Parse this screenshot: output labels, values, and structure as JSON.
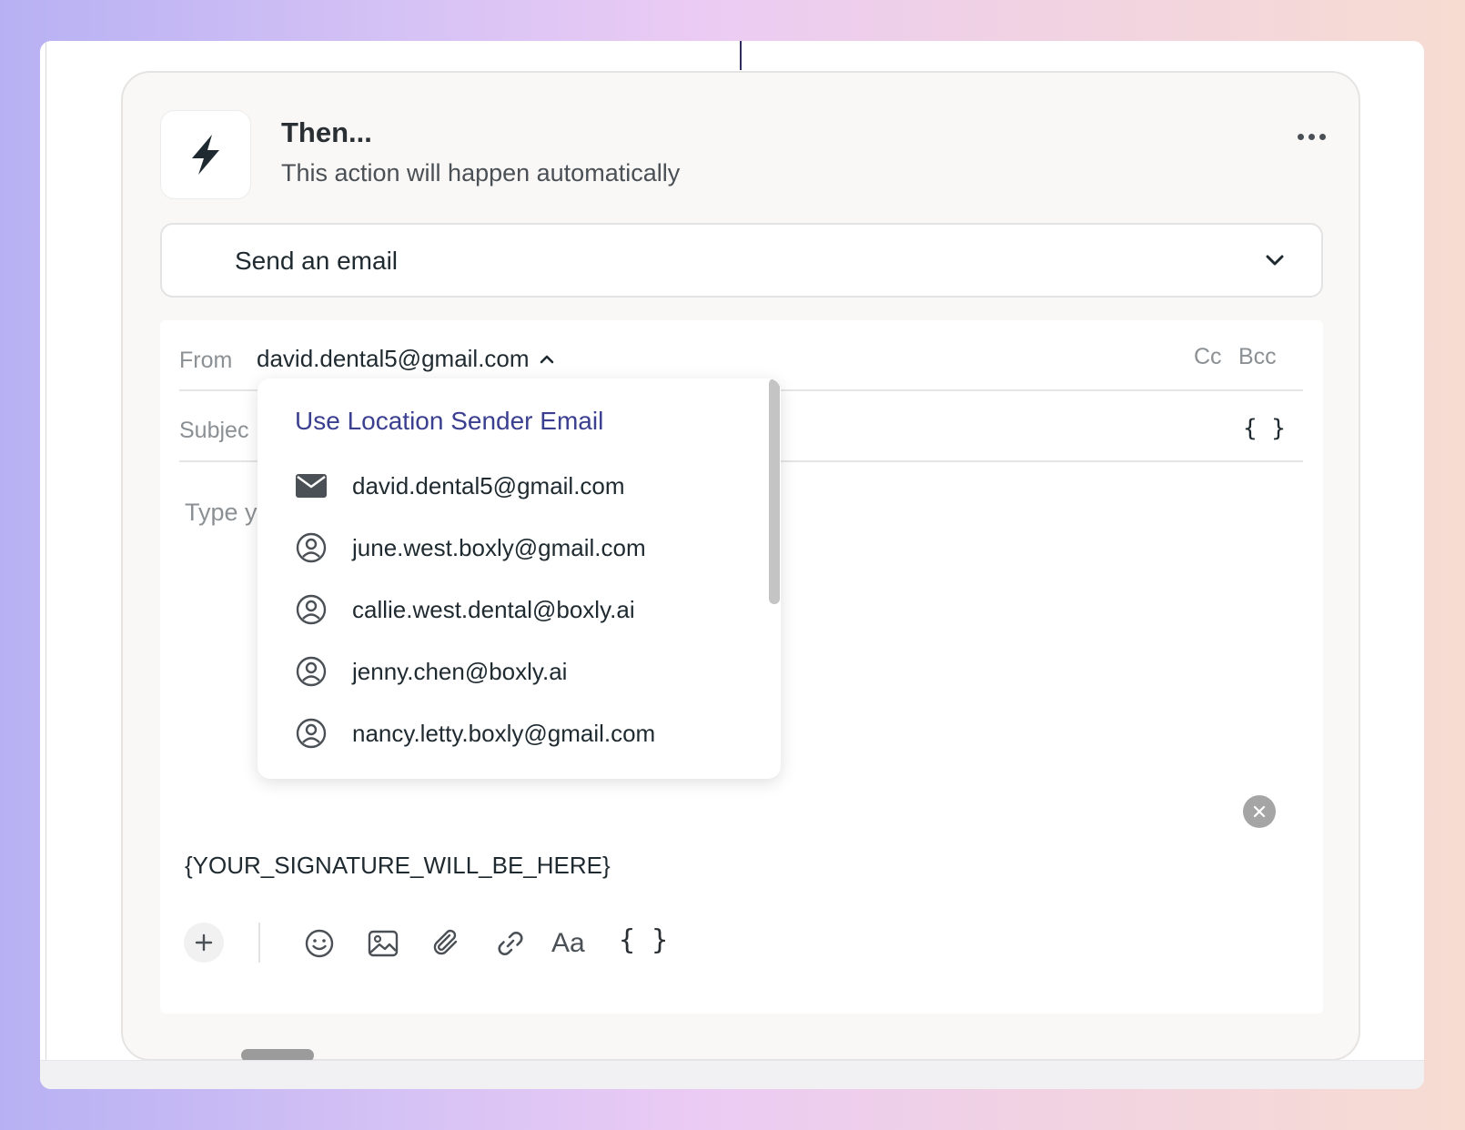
{
  "card": {
    "title": "Then...",
    "subtitle": "This action will happen automatically",
    "icon": "lightning-bolt-icon"
  },
  "action_select": {
    "value": "Send an email"
  },
  "email": {
    "from_label": "From",
    "from_value": "david.dental5@gmail.com",
    "cc_label": "Cc",
    "bcc_label": "Bcc",
    "subject_label": "Subjec",
    "body_placeholder": "Type y",
    "signature": "{YOUR_SIGNATURE_WILL_BE_HERE}",
    "variable_braces": "{ }"
  },
  "toolbar": {
    "text_format_label": "Aa",
    "variables_label": "{ }"
  },
  "sender_dropdown": {
    "header": "Use Location Sender Email",
    "items": [
      {
        "email": "david.dental5@gmail.com",
        "icon": "envelope-icon"
      },
      {
        "email": "june.west.boxly@gmail.com",
        "icon": "user-circle-icon"
      },
      {
        "email": "callie.west.dental@boxly.ai",
        "icon": "user-circle-icon"
      },
      {
        "email": "jenny.chen@boxly.ai",
        "icon": "user-circle-icon"
      },
      {
        "email": "nancy.letty.boxly@gmail.com",
        "icon": "user-circle-icon"
      }
    ]
  },
  "colors": {
    "accent": "#3a3f8f",
    "text": "#1f2a30",
    "muted": "#8b9094"
  }
}
